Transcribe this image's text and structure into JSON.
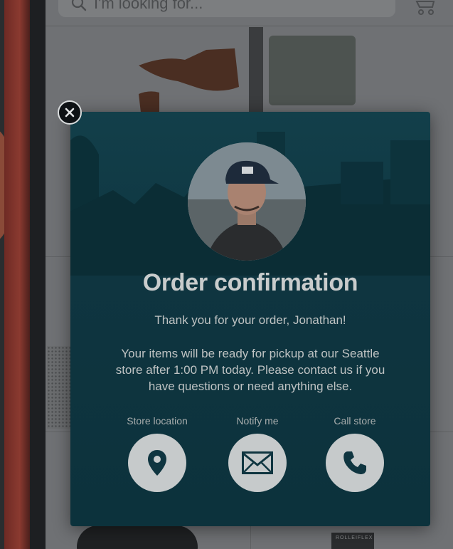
{
  "search": {
    "placeholder": "I'm looking for..."
  },
  "modal": {
    "title": "Order confirmation",
    "greeting": "Thank you for your order, Jonathan!",
    "message": "Your items will be ready for pickup at our Seattle store after 1:00 PM today. Please contact us if you have questions or need anything else.",
    "actions": [
      {
        "label": "Store location",
        "icon": "map-pin-icon"
      },
      {
        "label": "Notify me",
        "icon": "envelope-icon"
      },
      {
        "label": "Call store",
        "icon": "phone-icon"
      }
    ]
  },
  "background": {
    "camera_label": "ROLLEIFLEX"
  },
  "colors": {
    "modal_bg": "#0f3540",
    "button_bg": "#c6cacb",
    "icon": "#0f3540"
  }
}
